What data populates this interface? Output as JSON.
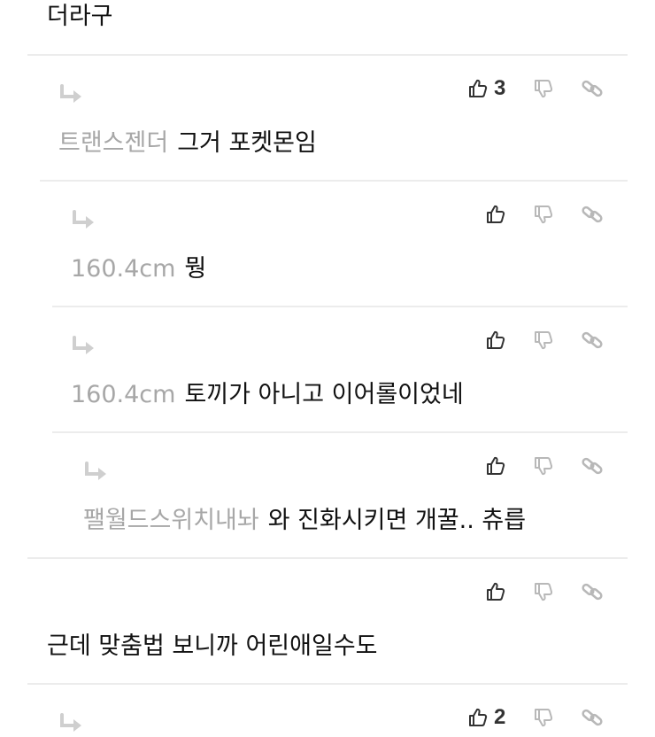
{
  "top_comment": {
    "text": "더라구"
  },
  "comments": [
    {
      "nickname": "트랜스젠더",
      "text": "그거 포켓몬임",
      "likes": "3"
    },
    {
      "nickname": "160.4cm",
      "text": "뭥",
      "likes": ""
    },
    {
      "nickname": "160.4cm",
      "text": "토끼가 아니고 이어롤이었네",
      "likes": ""
    },
    {
      "nickname": "팰월드스위치내놔",
      "text": "와 진화시키면 개꿀.. 츄릅",
      "likes": ""
    },
    {
      "nickname": "",
      "text": "근데 맞춤법 보니까 어린애일수도",
      "likes": ""
    },
    {
      "nickname": "",
      "text": "",
      "likes": "2"
    }
  ],
  "icons": {
    "reply": "reply-arrow-icon",
    "like": "thumbs-up-icon",
    "dislike": "thumbs-down-icon",
    "link": "link-icon"
  },
  "colors": {
    "nickname": "#a7a7a7",
    "divider": "#ececec",
    "icon_muted": "#b8b8b8",
    "icon_dark": "#333333",
    "reply_arrow": "#cfcfcf"
  }
}
